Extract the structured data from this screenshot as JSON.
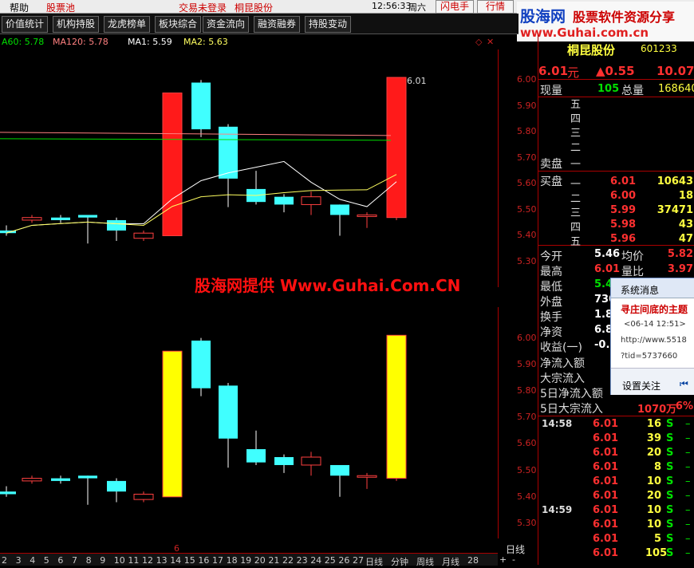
{
  "topbar": {
    "help": "帮助",
    "pool": "股票池",
    "trade_status": "交易未登录",
    "stock_name": "桐昆股份",
    "time": "12:56:33",
    "weekday": "周六",
    "btn_flash": "闪电手",
    "btn_quote": "行情"
  },
  "logo": {
    "line1": "股海网",
    "line2": "股票软件资源分享",
    "url": "www.Guhai.com.cn"
  },
  "toolbar": {
    "tabs": [
      "价值统计",
      "机构持股",
      "龙虎榜单",
      "板块综合",
      "资金流向",
      "融资融券",
      "持股变动"
    ]
  },
  "ma": {
    "ma60": "A60: 5.78",
    "ma120": "MA120: 5.78",
    "ma1": "MA1: 5.59",
    "ma2": "MA2: 5.63",
    "colors": {
      "ma60": "#00e000",
      "ma120": "#ff8080",
      "ma1": "#ffffff",
      "ma2": "#ffff60"
    }
  },
  "chart_data": [
    {
      "type": "candlestick",
      "title": "",
      "price_label": "6.01",
      "ylim": [
        5.3,
        6.05
      ],
      "y_ticks": [
        "6.00",
        "5.90",
        "5.80",
        "5.70",
        "5.60",
        "5.50",
        "5.40",
        "5.30"
      ],
      "candles": [
        {
          "o": 5.42,
          "c": 5.41,
          "h": 5.44,
          "l": 5.4
        },
        {
          "o": 5.46,
          "c": 5.47,
          "h": 5.48,
          "l": 5.45
        },
        {
          "o": 5.47,
          "c": 5.46,
          "h": 5.48,
          "l": 5.45
        },
        {
          "o": 5.48,
          "c": 5.47,
          "h": 5.48,
          "l": 5.37
        },
        {
          "o": 5.46,
          "c": 5.42,
          "h": 5.47,
          "l": 5.38
        },
        {
          "o": 5.39,
          "c": 5.41,
          "h": 5.42,
          "l": 5.38
        },
        {
          "o": 5.4,
          "c": 5.95,
          "h": 5.95,
          "l": 5.4
        },
        {
          "o": 5.99,
          "c": 5.81,
          "h": 6.0,
          "l": 5.78
        },
        {
          "o": 5.82,
          "c": 5.62,
          "h": 5.83,
          "l": 5.51
        },
        {
          "o": 5.58,
          "c": 5.53,
          "h": 5.65,
          "l": 5.52
        },
        {
          "o": 5.55,
          "c": 5.52,
          "h": 5.56,
          "l": 5.49
        },
        {
          "o": 5.52,
          "c": 5.55,
          "h": 5.57,
          "l": 5.48
        },
        {
          "o": 5.52,
          "c": 5.48,
          "h": 5.52,
          "l": 5.4
        },
        {
          "o": 5.48,
          "c": 5.48,
          "h": 5.49,
          "l": 5.43
        },
        {
          "o": 5.47,
          "c": 6.01,
          "h": 6.01,
          "l": 5.46
        }
      ]
    },
    {
      "type": "candlestick",
      "title": "",
      "ylim": [
        5.3,
        6.05
      ],
      "y_ticks": [
        "6.00",
        "5.90",
        "5.80",
        "5.70",
        "5.60",
        "5.50",
        "5.40",
        "5.30"
      ]
    }
  ],
  "watermark": "股海网提供 Www.Guhai.Com.CN",
  "panel": {
    "name": "桐昆股份",
    "code": "601233",
    "price": "6.01",
    "unit": "元",
    "change": "▲0.55",
    "pct": "10.07%",
    "xianliang_label": "现量",
    "xianliang": "105",
    "zongliang_label": "总量",
    "zongliang": "168640",
    "sell_labels": [
      "五",
      "四",
      "三",
      "二",
      "一"
    ],
    "sell_title": "卖盘",
    "buy_title": "买盘",
    "buy": [
      {
        "lv": "一",
        "price": "6.01",
        "vol": "10643"
      },
      {
        "lv": "二",
        "price": "6.00",
        "vol": "18"
      },
      {
        "lv": "三",
        "price": "5.99",
        "vol": "37471"
      },
      {
        "lv": "四",
        "price": "5.98",
        "vol": "43"
      },
      {
        "lv": "五",
        "price": "5.96",
        "vol": "47"
      }
    ],
    "stats": [
      {
        "l": "今开",
        "v": "5.46",
        "l2": "均价",
        "v2": "5.82"
      },
      {
        "l": "最高",
        "v": "6.01",
        "l2": "量比",
        "v2": "3.97"
      },
      {
        "l": "最低",
        "v": "5.4",
        "l2": "",
        "v2": ""
      },
      {
        "l": "外盘",
        "v": "7300",
        "l2": "",
        "v2": ""
      },
      {
        "l": "换手",
        "v": "1.87%",
        "l2": "",
        "v2": ""
      },
      {
        "l": "净资",
        "v": "6.8",
        "l2": "",
        "v2": ""
      },
      {
        "l": "收益(一)",
        "v": "-0.1",
        "l2": "",
        "v2": ""
      }
    ],
    "flows": [
      "净流入额",
      "大宗流入",
      "5日净流入额",
      "5日大宗流入"
    ],
    "flow_value": "1070万",
    "flow_pct": "6%",
    "ticks_time1": "14:58",
    "ticks_time2": "14:59",
    "ticks": [
      {
        "p": "6.01",
        "v": "16",
        "s": "S"
      },
      {
        "p": "6.01",
        "v": "39",
        "s": "S"
      },
      {
        "p": "6.01",
        "v": "20",
        "s": "S"
      },
      {
        "p": "6.01",
        "v": "8",
        "s": "S"
      },
      {
        "p": "6.01",
        "v": "10",
        "s": "S"
      },
      {
        "p": "6.01",
        "v": "20",
        "s": "S"
      },
      {
        "p": "6.01",
        "v": "10",
        "s": "S"
      },
      {
        "p": "6.01",
        "v": "10",
        "s": "S"
      },
      {
        "p": "6.01",
        "v": "5",
        "s": "S"
      },
      {
        "p": "6.01",
        "v": "105",
        "s": "S"
      }
    ]
  },
  "popup": {
    "title": "系统消息",
    "headline": "寻庄间底的主题",
    "date": "<06-14 12:51>",
    "url": "http://www.5518",
    "tid": "?tid=5737660",
    "settings": "设置关注"
  },
  "bottom": {
    "days": [
      "2",
      "3",
      "4",
      "5",
      "6",
      "7",
      "8",
      "9",
      "10",
      "11",
      "12",
      "13",
      "14",
      "15",
      "16",
      "17",
      "18",
      "19",
      "20",
      "21",
      "22",
      "23",
      "24",
      "25",
      "26",
      "27"
    ],
    "tabs": [
      "日线",
      "分钟",
      "周线",
      "月线",
      "28"
    ],
    "period": "日线",
    "month_mark": "6"
  }
}
